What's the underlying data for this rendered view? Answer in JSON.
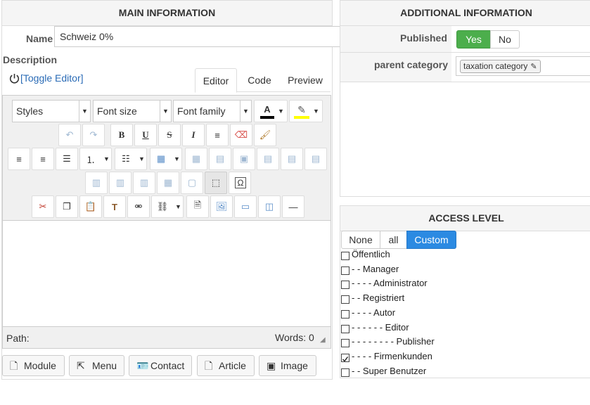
{
  "main": {
    "header": "MAIN INFORMATION",
    "name_label": "Name",
    "name_value": "Schweiz 0%",
    "description_label": "Description",
    "toggle_editor": "[Toggle Editor]",
    "tabs": [
      "Editor",
      "Code",
      "Preview"
    ],
    "toolbar": {
      "styles": "Styles",
      "font_size": "Font size",
      "font_family": "Font family"
    },
    "status": {
      "path": "Path:",
      "words": "Words: 0"
    },
    "insert_buttons": [
      "Module",
      "Menu",
      "Contact",
      "Article",
      "Image"
    ]
  },
  "additional": {
    "header": "ADDITIONAL INFORMATION",
    "published_label": "Published",
    "published_yes": "Yes",
    "published_no": "No",
    "parent_label": "parent category",
    "parent_value": "taxation category"
  },
  "access": {
    "header": "ACCESS LEVEL",
    "filters": [
      "None",
      "all",
      "Custom"
    ],
    "items": [
      {
        "label": "Öffentlich",
        "checked": false
      },
      {
        "label": "- - Manager",
        "checked": false
      },
      {
        "label": "- - - - Administrator",
        "checked": false
      },
      {
        "label": "- - Registriert",
        "checked": false
      },
      {
        "label": "- - - - Autor",
        "checked": false
      },
      {
        "label": "- - - - - - Editor",
        "checked": false
      },
      {
        "label": "- - - - - - - - Publisher",
        "checked": false
      },
      {
        "label": "- - - - Firmenkunden",
        "checked": true
      },
      {
        "label": "- - Super Benutzer",
        "checked": false
      }
    ]
  },
  "colors": {
    "accent_green": "#4cae4c",
    "accent_blue": "#2b8ae2",
    "link": "#2a6bb6"
  }
}
